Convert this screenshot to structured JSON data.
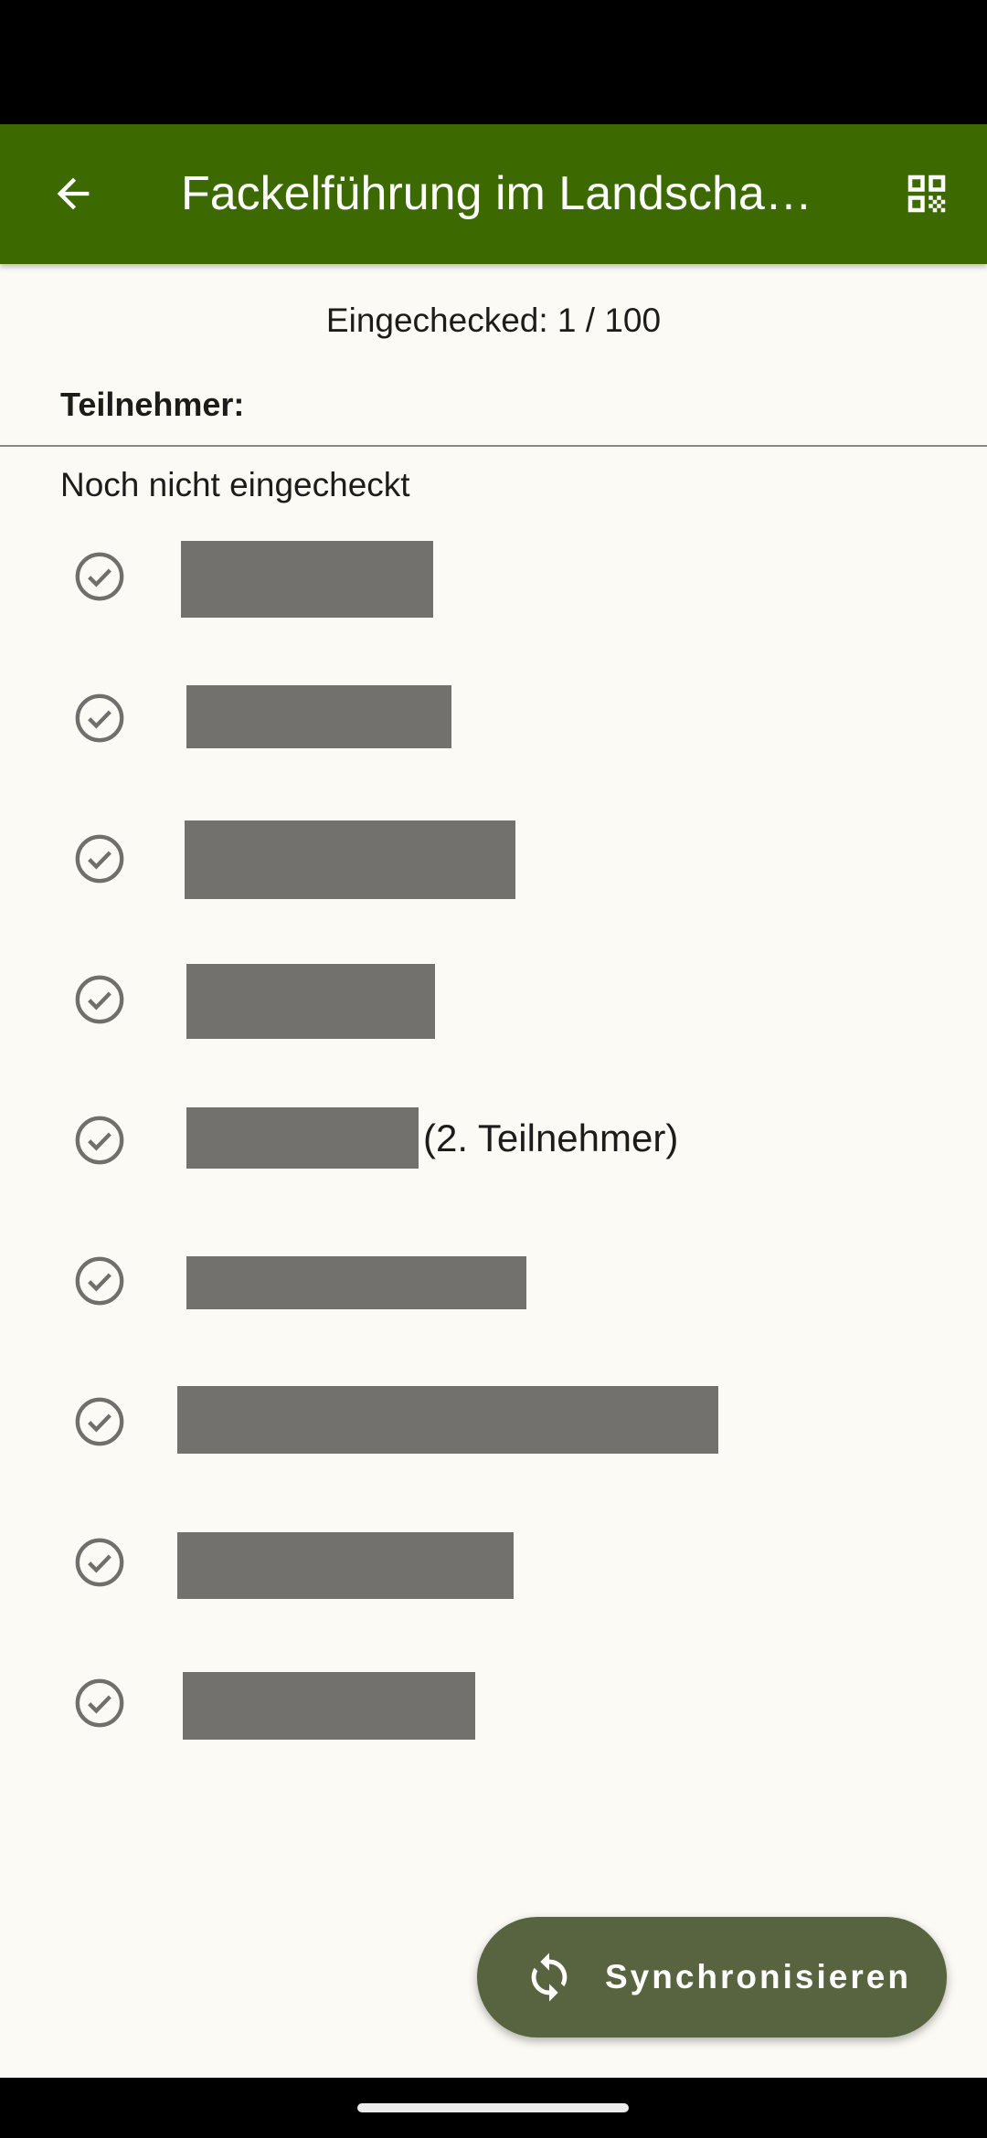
{
  "app_bar": {
    "title": "Fackelführung im Landschaftspark",
    "back_icon": "arrow-back-icon",
    "qr_icon": "qr-code-icon",
    "color": "#3d6a00"
  },
  "counter_text": "Eingechecked: 1 / 100",
  "section_label": "Teilnehmer:",
  "group_label": "Noch nicht eingecheckt",
  "participants": [
    {
      "name_redacted": true,
      "suffix": ""
    },
    {
      "name_redacted": true,
      "suffix": ""
    },
    {
      "name_redacted": true,
      "suffix": ""
    },
    {
      "name_redacted": true,
      "suffix": ""
    },
    {
      "name_redacted": true,
      "suffix": "(2. Teilnehmer)"
    },
    {
      "name_redacted": true,
      "suffix": ""
    },
    {
      "name_redacted": true,
      "suffix": ""
    },
    {
      "name_redacted": true,
      "suffix": ""
    },
    {
      "name_redacted": true,
      "suffix": ""
    }
  ],
  "check_icon": "check-circle-outline-icon",
  "fab": {
    "label": "Synchronisieren",
    "icon": "sync-icon",
    "color": "#57643f"
  }
}
